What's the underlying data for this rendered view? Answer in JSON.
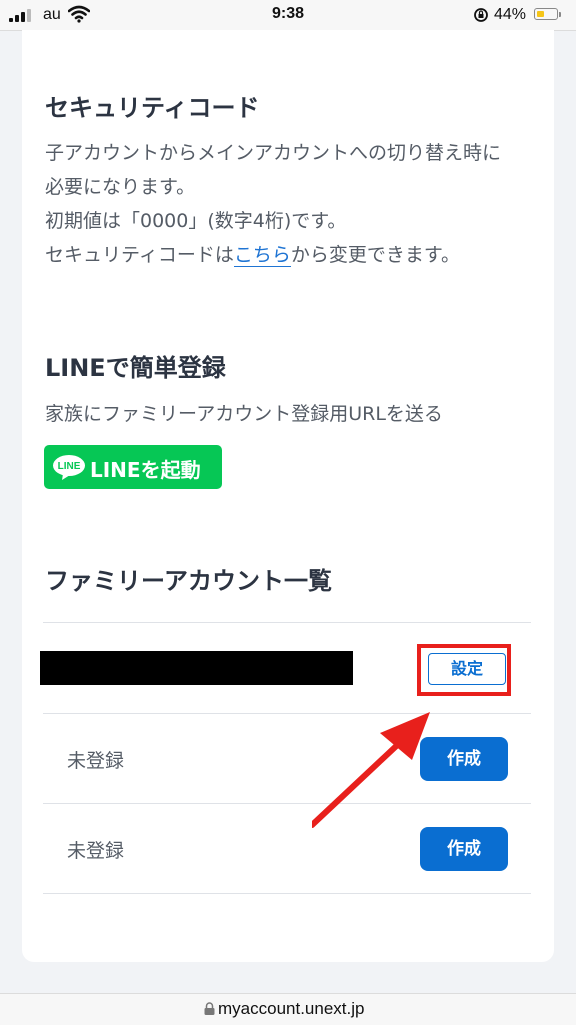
{
  "status_bar": {
    "carrier": "au",
    "time": "9:38",
    "battery_percent": "44%",
    "battery_level": 0.44
  },
  "security_code": {
    "title": "セキュリティコード",
    "line1": "子アカウントからメインアカウントへの切り替え時に",
    "line2": "必要になります。",
    "line3": "初期値は「0000」(数字4桁)です。",
    "line4_prefix": "セキュリティコードは",
    "line4_link": "こちら",
    "line4_suffix": "から変更できます。"
  },
  "line_register": {
    "title": "LINEで簡単登録",
    "description": "家族にファミリーアカウント登録用URLを送る",
    "button_label": "LINEを起動",
    "logo_text": "LINE",
    "button_color": "#06c755"
  },
  "family_accounts": {
    "title": "ファミリーアカウント一覧",
    "rows": [
      {
        "label": "",
        "button": "設定"
      },
      {
        "label": "未登録",
        "button": "作成"
      },
      {
        "label": "未登録",
        "button": "作成"
      }
    ],
    "highlight_color": "#e8201c",
    "accent_color": "#0a6ed1"
  },
  "url_bar": {
    "url": "myaccount.unext.jp"
  }
}
